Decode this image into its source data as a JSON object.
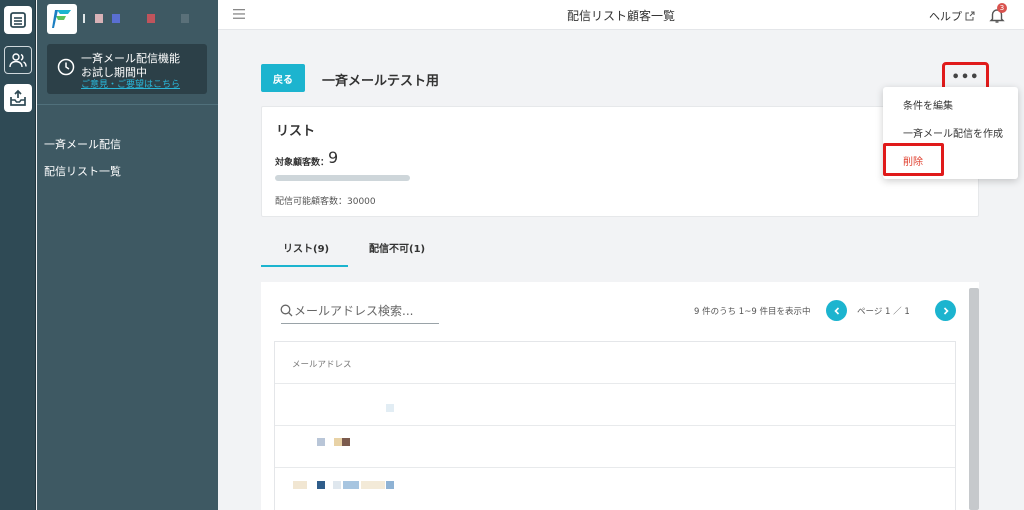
{
  "sidebar": {
    "trial_line1": "一斉メール配信機能",
    "trial_line2": "お試し期間中",
    "trial_link": "ご意見・ご要望はこちら",
    "nav": [
      "一斉メール配信",
      "配信リスト一覧"
    ]
  },
  "topbar": {
    "title": "配信リスト顧客一覧",
    "help_label": "ヘルプ",
    "notification_count": "3"
  },
  "header": {
    "back_label": "戻る",
    "list_name": "一斉メールテスト用",
    "more_label": "•••"
  },
  "list_card": {
    "title": "リスト",
    "count_label": "対象顧客数：",
    "count_value": "9",
    "deliverable_text": "配信可能顧客数：30000"
  },
  "dropdown": {
    "edit_conditions": "条件を編集",
    "create_mail": "一斉メール配信を作成",
    "delete": "削除"
  },
  "tabs": [
    "リスト(9)",
    "配信不可(1)"
  ],
  "table": {
    "search_placeholder": "メールアドレス検索...",
    "range_text": "9 件のうち 1~9 件目を表示中",
    "page_text": "ページ 1 ／ 1",
    "column_email": "メールアドレス"
  },
  "colors": {
    "accent": "#1cb4cf",
    "highlight": "#e01a1a",
    "sidebar": "#3e5963",
    "rail": "#2f4a55"
  }
}
